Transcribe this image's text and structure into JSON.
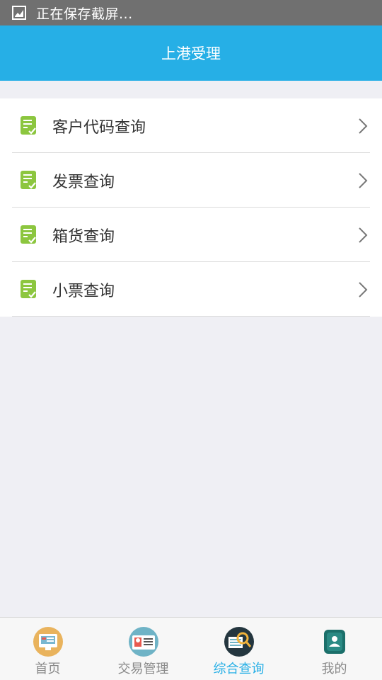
{
  "status_bar": {
    "text": "正在保存截屏...",
    "icon": "screenshot-image-icon"
  },
  "header": {
    "title": "上港受理"
  },
  "menu": {
    "items": [
      {
        "label": "客户代码查询",
        "icon": "document-check-icon"
      },
      {
        "label": "发票查询",
        "icon": "document-check-icon"
      },
      {
        "label": "箱货查询",
        "icon": "document-check-icon"
      },
      {
        "label": "小票查询",
        "icon": "document-check-icon"
      }
    ]
  },
  "tabbar": {
    "tabs": [
      {
        "label": "首页",
        "icon": "home-monitor-icon",
        "active": false
      },
      {
        "label": "交易管理",
        "icon": "id-card-icon",
        "active": false
      },
      {
        "label": "综合查询",
        "icon": "search-magnifier-icon",
        "active": true
      },
      {
        "label": "我的",
        "icon": "user-profile-icon",
        "active": false
      }
    ]
  },
  "colors": {
    "header_bg": "#26afe6",
    "active_tab": "#26afe6",
    "icon_green": "#8cc63f",
    "status_bar_bg": "#707070"
  }
}
